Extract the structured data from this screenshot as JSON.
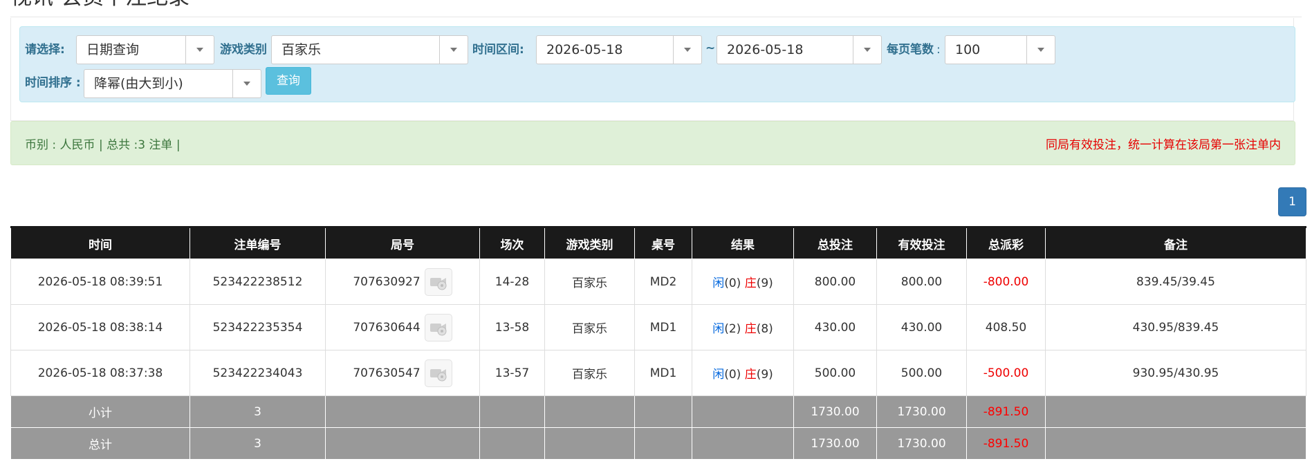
{
  "page": {
    "title": "视讯-会员下注纪录"
  },
  "filters": {
    "select_label": "请选择:",
    "select_value": "日期查询",
    "game_type_label": "游戏类别",
    "game_type_value": "百家乐",
    "time_range_label": "时间区间:",
    "date_from": "2026-05-18",
    "tilde": "~",
    "date_to": "2026-05-18",
    "per_page_label": "每页笔数",
    "per_page_colon": ":",
    "per_page_value": "100",
    "sort_label": "时间排序 :",
    "sort_value": "降幂(由大到小)",
    "query_button": "查询"
  },
  "info": {
    "summary": "币别 : 人民币 | 总共 :3 注单 |",
    "notice": "同局有效投注，统一计算在该局第一张注单内"
  },
  "pagination": {
    "current_page": "1"
  },
  "table": {
    "headers": [
      "时间",
      "注单编号",
      "局号",
      "场次",
      "游戏类别",
      "桌号",
      "结果",
      "总投注",
      "有效投注",
      "总派彩",
      "备注"
    ],
    "rows": [
      {
        "time": "2026-05-18 08:39:51",
        "bet_id": "523422238512",
        "round": "707630927",
        "session": "14-28",
        "game": "百家乐",
        "table": "MD2",
        "player_label": "闲",
        "player_score": "(0)",
        "banker_label": "庄",
        "banker_score": "(9)",
        "total_bet": "800.00",
        "valid_bet": "800.00",
        "payout": "-800.00",
        "payout_color": "#ee0000",
        "remark": "839.45/39.45"
      },
      {
        "time": "2026-05-18 08:38:14",
        "bet_id": "523422235354",
        "round": "707630644",
        "session": "13-58",
        "game": "百家乐",
        "table": "MD1",
        "player_label": "闲",
        "player_score": "(2)",
        "banker_label": "庄",
        "banker_score": "(8)",
        "total_bet": "430.00",
        "valid_bet": "430.00",
        "payout": "408.50",
        "payout_color": "#333333",
        "remark": "430.95/839.45"
      },
      {
        "time": "2026-05-18 08:37:38",
        "bet_id": "523422234043",
        "round": "707630547",
        "session": "13-57",
        "game": "百家乐",
        "table": "MD1",
        "player_label": "闲",
        "player_score": "(0)",
        "banker_label": "庄",
        "banker_score": "(9)",
        "total_bet": "500.00",
        "valid_bet": "500.00",
        "payout": "-500.00",
        "payout_color": "#ee0000",
        "remark": "930.95/430.95"
      }
    ],
    "subtotal": {
      "label": "小计",
      "count": "3",
      "total_bet": "1730.00",
      "valid_bet": "1730.00",
      "payout": "-891.50"
    },
    "grand_total": {
      "label": "总计",
      "count": "3",
      "total_bet": "1730.00",
      "valid_bet": "1730.00",
      "payout": "-891.50"
    }
  },
  "colors": {
    "header_bg": "#1a1a1a",
    "filter_bg": "#d9edf7",
    "info_bg": "#dff0d8",
    "button_info": "#5bc0de",
    "button_primary": "#337ab7",
    "summary_row_bg": "#999999",
    "amount_blue": "#0066dd",
    "amount_red": "#ee0000"
  },
  "icons": {
    "replay": "video-replay-icon",
    "dropdown": "chevron-down-icon"
  }
}
